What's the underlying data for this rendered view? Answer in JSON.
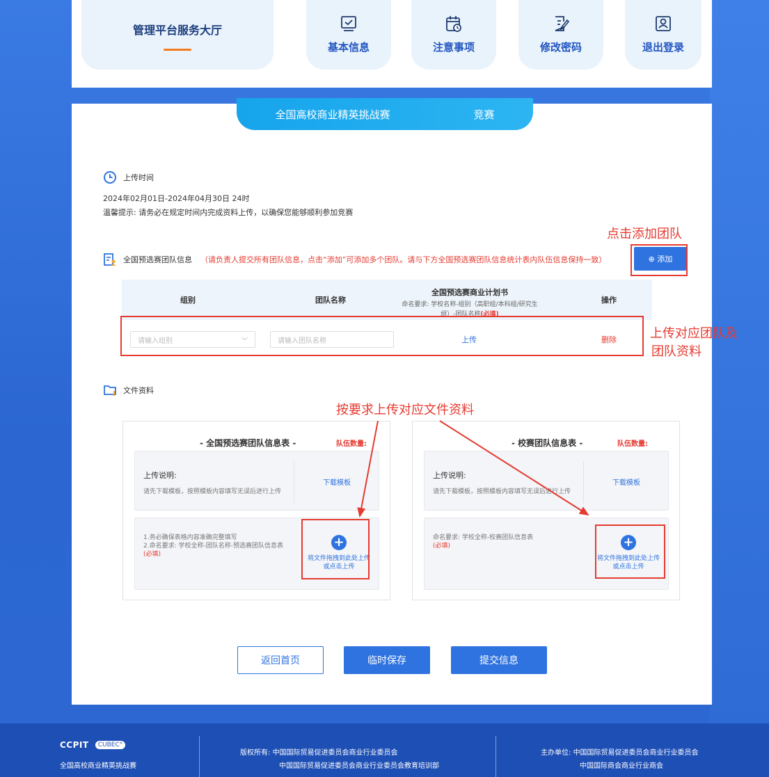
{
  "nav": {
    "main_title": "管理平台服务大厅",
    "items": [
      {
        "label": "基本信息",
        "icon": "checkbox-screen-icon"
      },
      {
        "label": "注意事项",
        "icon": "calendar-clock-icon"
      },
      {
        "label": "修改密码",
        "icon": "edit-document-icon"
      },
      {
        "label": "退出登录",
        "icon": "user-badge-icon"
      }
    ]
  },
  "banner": {
    "part1": "全国高校商业精英挑战赛",
    "part2": "竞赛"
  },
  "upload_time": {
    "title": "上传时间",
    "range": "2024年02月01日-2024年04月30日 24时",
    "tip": "温馨提示: 请务必在规定时间内完成资料上传，以确保您能够顺利参加竞赛"
  },
  "team_info": {
    "title": "全国预选赛团队信息",
    "note": "（请负责人提交所有团队信息，点击“添加”可添加多个团队。请与下方全国预选赛团队信息统计表内队伍信息保持一致）",
    "add_button": "⊕ 添加"
  },
  "table": {
    "headers": {
      "group": "组别",
      "team_name": "团队名称",
      "plan_title": "全国预选赛商业计划书",
      "plan_desc": "命名要求: 学校名称-组别（高职组/本科组/研究生组）-团队名称",
      "plan_required": "(必填)",
      "action": "操作"
    },
    "row": {
      "group_placeholder": "请输入组别",
      "team_placeholder": "请输入团队名称",
      "upload": "上传",
      "delete": "删除"
    }
  },
  "files": {
    "title": "文件资料",
    "left": {
      "title": "- 全国预选赛团队信息表 -",
      "count_label": "队伍数量:",
      "upload_label": "上传说明:",
      "upload_desc": "请先下载模板，按照模板内容填写无误后进行上传",
      "download": "下载模板",
      "req1": "1.务必确保表格内容准确完整填写",
      "req2": "2.命名要求: 学校全称-团队名称-预选赛团队信息表",
      "required": "(必填)",
      "drop_text1": "将文件拖拽到此处上传",
      "drop_text2": "或点击上传"
    },
    "right": {
      "title": "- 校赛团队信息表 -",
      "count_label": "队伍数量:",
      "upload_label": "上传说明:",
      "upload_desc": "请先下载模板，按照模板内容填写无误后进行上传",
      "download": "下载模板",
      "req1": "命名要求: 学校全称-校赛团队信息表",
      "required": "(必填)",
      "drop_text1": "将文件拖拽到此处上传",
      "drop_text2": "或点击上传"
    }
  },
  "buttons": {
    "home": "返回首页",
    "save": "临时保存",
    "submit": "提交信息"
  },
  "annotations": {
    "add_team": "点击添加团队",
    "upload_team_1": "上传对应团队及",
    "upload_team_2": "团队资料",
    "upload_files": "按要求上传对应文件资料"
  },
  "footer": {
    "logo1": "CCPIT",
    "logo2": "CUBEC°",
    "logo_caption": "全国高校商业精英挑战赛",
    "copyright_label": "版权所有: ",
    "copyright_1": "中国国际贸易促进委员会商业行业委员会",
    "copyright_2": "中国国际贸易促进委员会商业行业委员会教育培训部",
    "host_label": "主办单位: ",
    "host_1": "中国国际贸易促进委员会商业行业委员会",
    "host_2": "中国国际商会商业行业商会"
  },
  "colors": {
    "primary": "#2f73e0",
    "danger": "#e53a30",
    "accent": "#f57a1f"
  }
}
